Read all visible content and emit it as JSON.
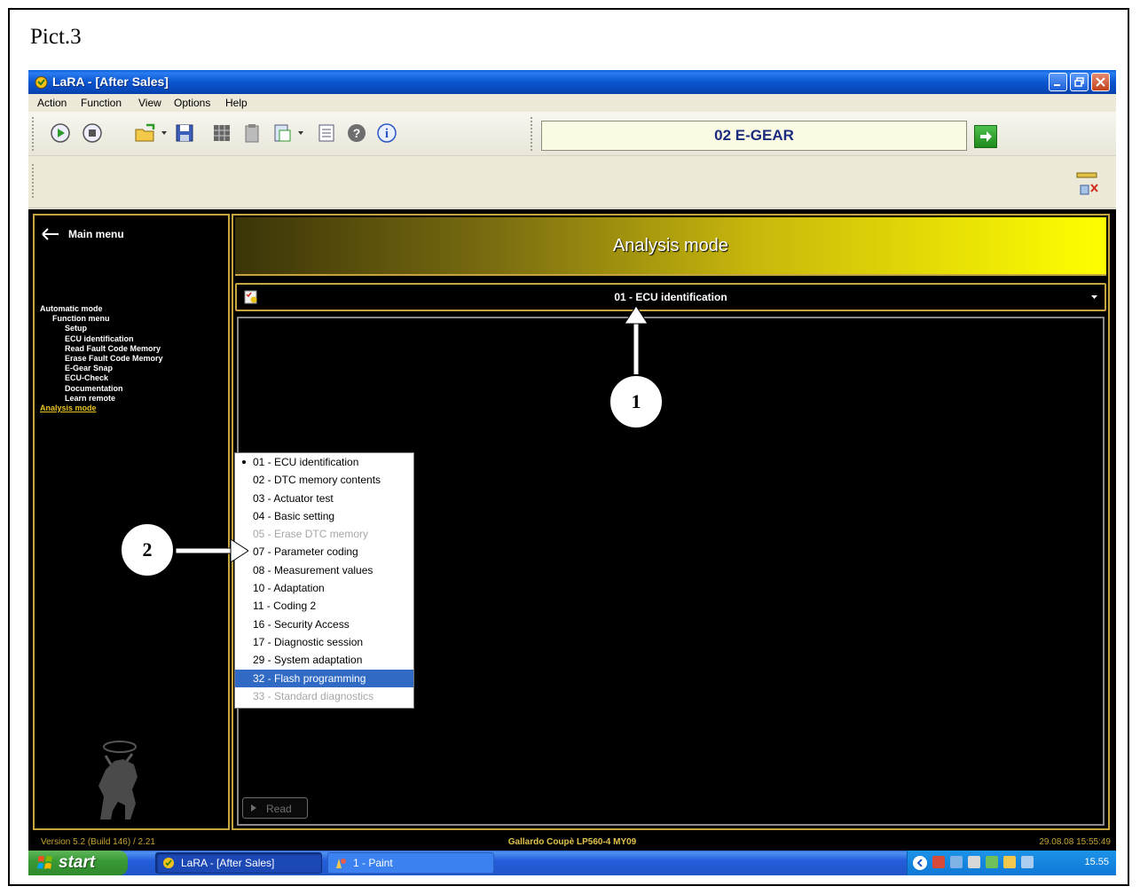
{
  "figure_label": "Pict.3",
  "window": {
    "title": "LaRA - [After Sales]"
  },
  "menubar": {
    "items": [
      "Action",
      "Function",
      "View",
      "Options",
      "Help"
    ]
  },
  "toolbar": {
    "ecu_value": "02  E-GEAR",
    "icons": [
      "play-icon",
      "stop-icon",
      "open-folder-icon",
      "save-icon",
      "grid-icon",
      "clipboard-icon",
      "paste-icon",
      "list-icon",
      "help-icon",
      "info-icon"
    ]
  },
  "left_panel": {
    "main_menu_label": "Main menu",
    "tree": [
      {
        "label": "Automatic mode",
        "level": 0,
        "selected": false
      },
      {
        "label": "Function menu",
        "level": 1,
        "selected": false
      },
      {
        "label": "Setup",
        "level": 2,
        "selected": false
      },
      {
        "label": "ECU identification",
        "level": 2,
        "selected": false
      },
      {
        "label": "Read Fault Code Memory",
        "level": 2,
        "selected": false
      },
      {
        "label": "Erase Fault Code Memory",
        "level": 2,
        "selected": false
      },
      {
        "label": "E-Gear Snap",
        "level": 2,
        "selected": false
      },
      {
        "label": "ECU-Check",
        "level": 2,
        "selected": false
      },
      {
        "label": "Documentation",
        "level": 2,
        "selected": false
      },
      {
        "label": "Learn remote",
        "level": 2,
        "selected": false
      },
      {
        "label": "Analysis mode",
        "level": 0,
        "selected": true
      }
    ]
  },
  "main": {
    "mode_title": "Analysis mode",
    "selected_function": "01 - ECU identification",
    "read_button_label": "Read"
  },
  "function_list": [
    {
      "label": "01 - ECU identification",
      "state": "current"
    },
    {
      "label": "02 - DTC memory contents",
      "state": "normal"
    },
    {
      "label": "03 - Actuator test",
      "state": "normal"
    },
    {
      "label": "04 - Basic setting",
      "state": "normal"
    },
    {
      "label": "05 - Erase DTC memory",
      "state": "disabled"
    },
    {
      "label": "07 - Parameter coding",
      "state": "normal"
    },
    {
      "label": "08 - Measurement values",
      "state": "normal"
    },
    {
      "label": "10 - Adaptation",
      "state": "normal"
    },
    {
      "label": "11 - Coding 2",
      "state": "normal"
    },
    {
      "label": "16 - Security Access",
      "state": "normal"
    },
    {
      "label": "17 - Diagnostic session",
      "state": "normal"
    },
    {
      "label": "29 - System adaptation",
      "state": "normal"
    },
    {
      "label": "32 - Flash programming",
      "state": "highlighted"
    },
    {
      "label": "33 - Standard diagnostics",
      "state": "disabled"
    }
  ],
  "statusbar": {
    "version": "Version 5.2 (Build 146) / 2.21",
    "vehicle": "Gallardo Coupè LP560-4 MY09",
    "datetime": "29.08.08 15:55:49"
  },
  "taskbar": {
    "start_label": "start",
    "tasks": [
      "LaRA - [After Sales]",
      "1 - Paint"
    ],
    "clock": "15.55"
  },
  "annotations": {
    "callout_1": "1",
    "callout_2": "2"
  },
  "colors": {
    "gold_border": "#c6a540",
    "highlight": "#316ac5",
    "ecu_text": "#1b2b7e"
  }
}
